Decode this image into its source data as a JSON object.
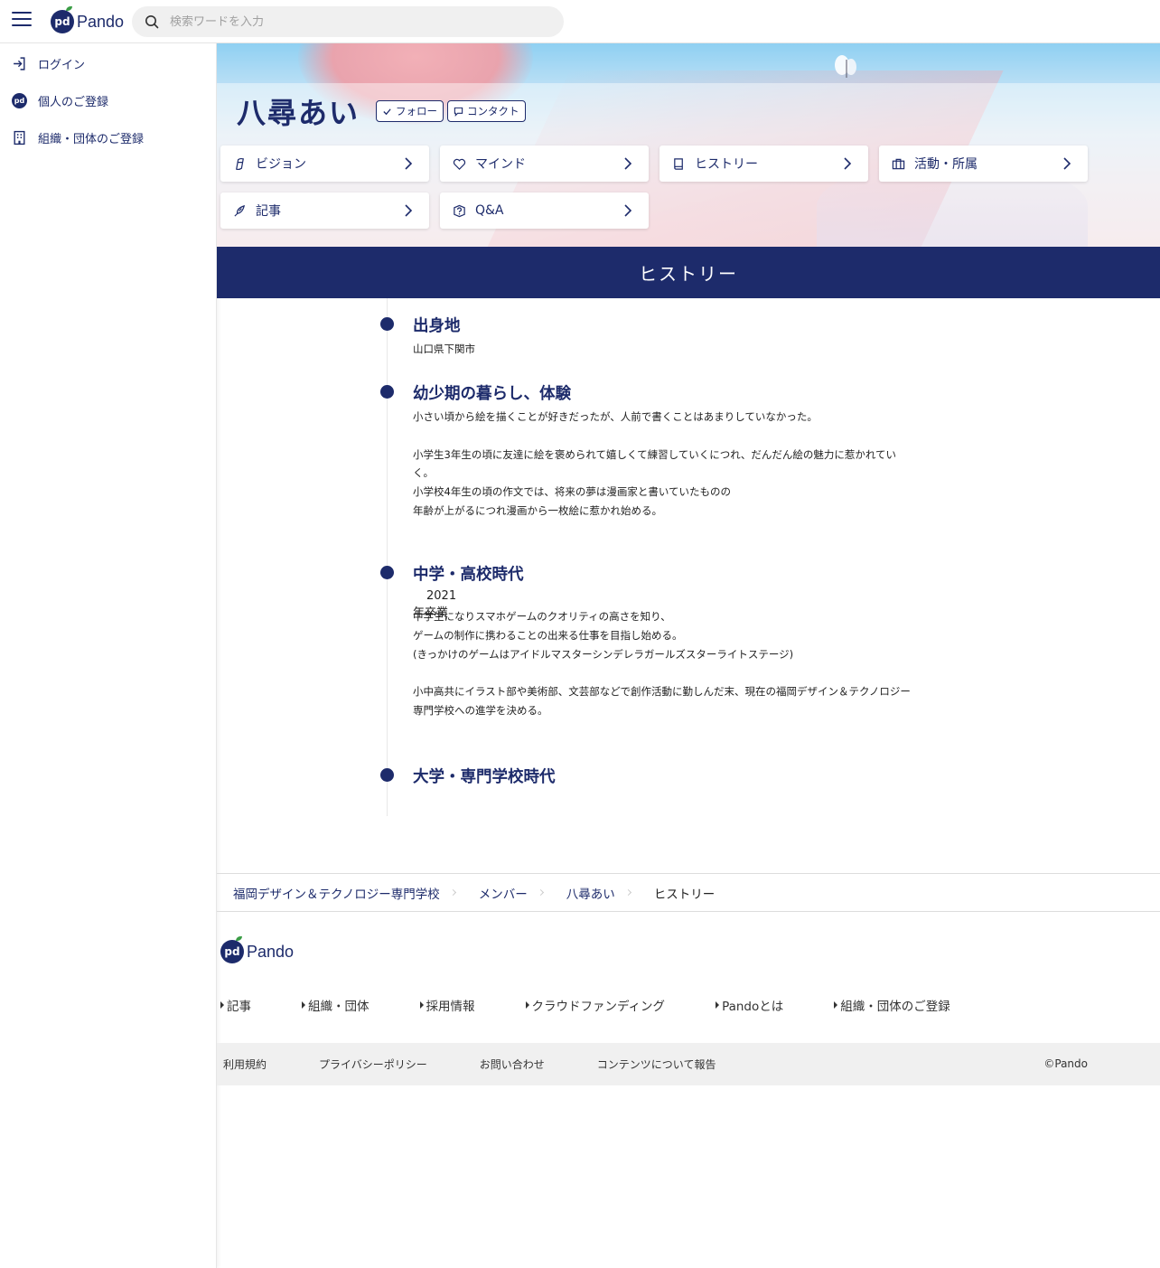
{
  "header": {
    "logo_text": "Pando",
    "logo_mark": "pd",
    "search_placeholder": "検索ワードを入力"
  },
  "sidebar": {
    "items": [
      {
        "label": "ログイン",
        "icon": "login-icon"
      },
      {
        "label": "個人のご登録",
        "icon": "pando-logo-icon"
      },
      {
        "label": "組織・団体のご登録",
        "icon": "building-icon"
      }
    ]
  },
  "profile": {
    "name": "八尋あい",
    "follow_label": "フォロー",
    "contact_label": "コンタクト"
  },
  "nav": [
    {
      "label": "ビジョン",
      "icon": "vision-icon"
    },
    {
      "label": "マインド",
      "icon": "heart-icon"
    },
    {
      "label": "ヒストリー",
      "icon": "book-icon"
    },
    {
      "label": "活動・所属",
      "icon": "briefcase-icon"
    },
    {
      "label": "記事",
      "icon": "pen-icon"
    },
    {
      "label": "Q&A",
      "icon": "question-icon"
    }
  ],
  "section_title": "ヒストリー",
  "timeline": [
    {
      "title": "出身地",
      "body": "山口県下関市"
    },
    {
      "title": "幼少期の暮らし、体験",
      "body": "小さい頃から絵を描くことが好きだったが、人前で書くことはあまりしていなかった。\n\n小学生3年生の頃に友達に絵を褒められて嬉しくて練習していくにつれ、だんだん絵の魅力に惹かれてい\nく。\n小学校4年生の頃の作文では、将来の夢は漫画家と書いていたものの\n年齢が上がるにつれ漫画から一枚絵に惹かれ始める。"
    },
    {
      "title": "中学・高校時代",
      "year": "2021年卒業",
      "body": "中学生になりスマホゲームのクオリティの高さを知り、\nゲームの制作に携わることの出来る仕事を目指し始める。\n(きっかけのゲームはアイドルマスターシンデレラガールズスターライトステージ)\n\n小中高共にイラスト部や美術部、文芸部などで創作活動に勤しんだ末、現在の福岡デザイン＆テクノロジー\n専門学校への進学を決める。"
    },
    {
      "title": "大学・専門学校時代",
      "body": ""
    }
  ],
  "breadcrumb": [
    "福岡デザイン＆テクノロジー専門学校",
    "メンバー",
    "八尋あい",
    "ヒストリー"
  ],
  "footer": {
    "logo_text": "Pando",
    "logo_mark": "pd",
    "links": [
      "記事",
      "組織・団体",
      "採用情報",
      "クラウドファンディング",
      "Pandoとは",
      "組織・団体のご登録"
    ],
    "sub_links": [
      "利用規約",
      "プライバシーポリシー",
      "お問い合わせ",
      "コンテンツについて報告"
    ],
    "copyright": "©Pando"
  },
  "colors": {
    "brand_navy": "#1d2b6b",
    "brand_green": "#3a9d45",
    "subfooter_bg": "#f0f0f0"
  }
}
